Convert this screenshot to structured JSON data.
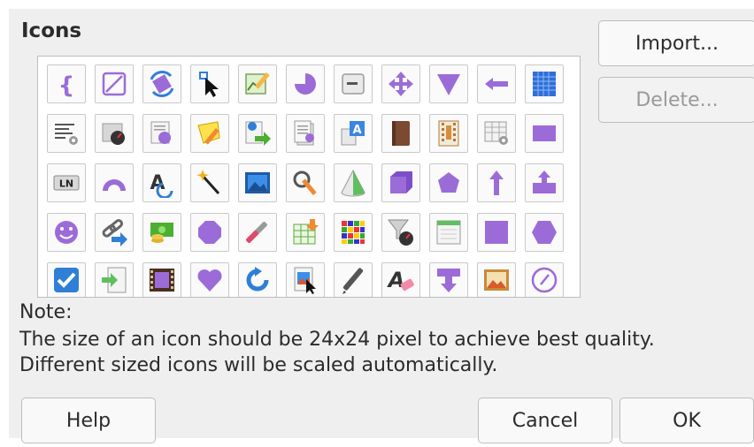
{
  "dialog": {
    "title": "Icons",
    "buttons": {
      "import": "Import...",
      "delete": "Delete...",
      "help": "Help",
      "cancel": "Cancel",
      "ok": "OK"
    },
    "note": {
      "label": "Note:",
      "line1": "The size of an icon should be 24x24 pixel to achieve best quality.",
      "line2": "Different sized icons will be scaled automatically."
    },
    "icons": [
      "brace-icon",
      "diagonal-square-icon",
      "rotate-icon",
      "cursor-select-icon",
      "chart-edit-icon",
      "pie-icon",
      "minus-box-icon",
      "move-arrows-icon",
      "triangle-down-icon",
      "arrow-left-icon",
      "table-grid-icon",
      "text-settings-icon",
      "gauge-icon",
      "document-circle-icon",
      "note-pencil-icon",
      "export-arrow-icon",
      "page-stack-icon",
      "text-frame-icon",
      "book-icon",
      "film-strip-icon",
      "table-settings-icon",
      "rectangle-icon",
      "ln-label-icon",
      "arc-icon",
      "font-rotate-icon",
      "magic-wand-icon",
      "picture-frame-icon",
      "magnifier-pencil-icon",
      "cone-icon",
      "cube-icon",
      "pentagon-icon",
      "arrow-up-icon",
      "up-arrow-shape-icon",
      "smiley-icon",
      "link-arrow-icon",
      "money-icon",
      "circle-icon",
      "eyedropper-icon",
      "table-insert-icon",
      "color-grid-icon",
      "funnel-gauge-icon",
      "window-icon",
      "square-icon",
      "hexagon-icon",
      "checkbox-icon",
      "import-arrow-icon",
      "film-frame-icon",
      "heart-icon",
      "refresh-icon",
      "picture-cursor-icon",
      "pen-icon",
      "font-eraser-icon",
      "arrow-down-callout-icon",
      "image-frame-icon",
      "round-square-icon"
    ]
  }
}
